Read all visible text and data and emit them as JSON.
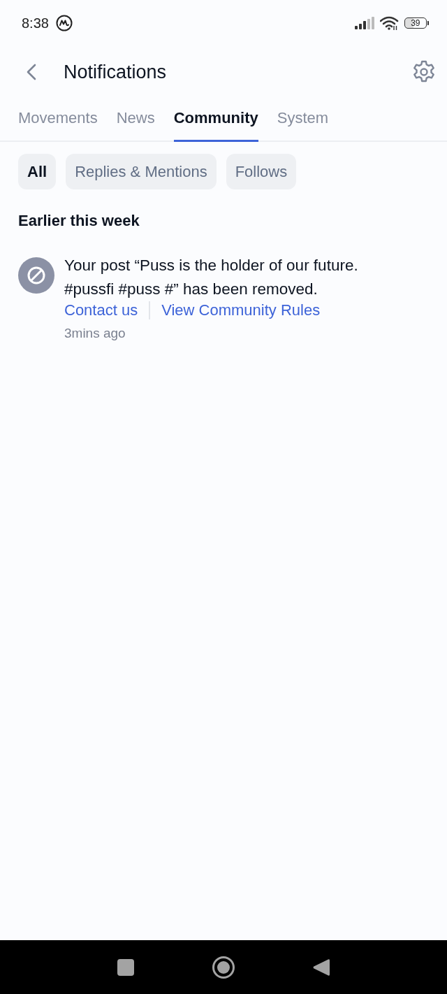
{
  "status_bar": {
    "time": "8:38",
    "battery": "39"
  },
  "header": {
    "title": "Notifications"
  },
  "tabs": [
    {
      "label": "Movements",
      "selected": false
    },
    {
      "label": "News",
      "selected": false
    },
    {
      "label": "Community",
      "selected": true
    },
    {
      "label": "System",
      "selected": false
    }
  ],
  "filters": [
    {
      "label": "All",
      "selected": true
    },
    {
      "label": "Replies & Mentions",
      "selected": false
    },
    {
      "label": "Follows",
      "selected": false
    }
  ],
  "section": {
    "heading": "Earlier this week"
  },
  "notifications": [
    {
      "message": "Your post “Puss is the holder of our future. #pussfi #puss #” has been removed.",
      "links": [
        "Contact us",
        "View Community Rules"
      ],
      "time": "3mins ago"
    }
  ]
}
